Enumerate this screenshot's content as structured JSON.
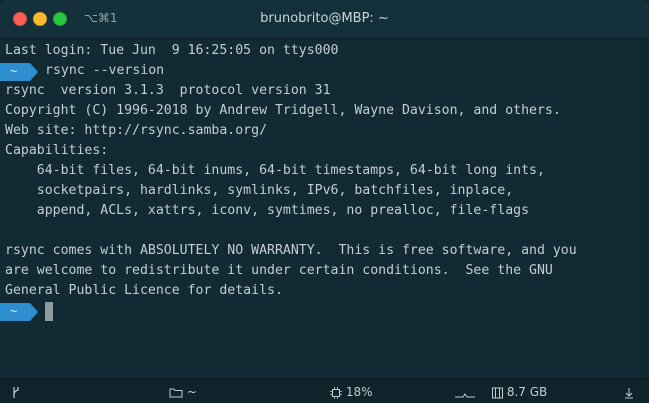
{
  "titlebar": {
    "shortcut": "⌥⌘1",
    "title": "brunobrito@MBP: ~"
  },
  "terminal": {
    "lines": [
      "Last login: Tue Jun  9 16:25:05 on ttys000",
      "rsync --version",
      "rsync  version 3.1.3  protocol version 31",
      "Copyright (C) 1996-2018 by Andrew Tridgell, Wayne Davison, and others.",
      "Web site: http://rsync.samba.org/",
      "Capabilities:",
      "    64-bit files, 64-bit inums, 64-bit timestamps, 64-bit long ints,",
      "    socketpairs, hardlinks, symlinks, IPv6, batchfiles, inplace,",
      "    append, ACLs, xattrs, iconv, symtimes, no prealloc, file-flags",
      "",
      "rsync comes with ABSOLUTELY NO WARRANTY.  This is free software, and you",
      "are welcome to redistribute it under certain conditions.  See the GNU",
      "General Public Licence for details."
    ],
    "prompt_label": "~"
  },
  "statusbar": {
    "folder": "~",
    "cpu": "18%",
    "memory": "8.7 GB"
  },
  "icons": {
    "branch": "git-branch-icon",
    "folder": "folder-icon",
    "cpu": "cpu-chip-icon",
    "network": "network-graph-icon",
    "memory": "memory-icon",
    "download": "download-arrow-icon"
  },
  "colors": {
    "background": "#122a33",
    "prompt": "#2e8fd0",
    "text": "#c4cdd0"
  }
}
